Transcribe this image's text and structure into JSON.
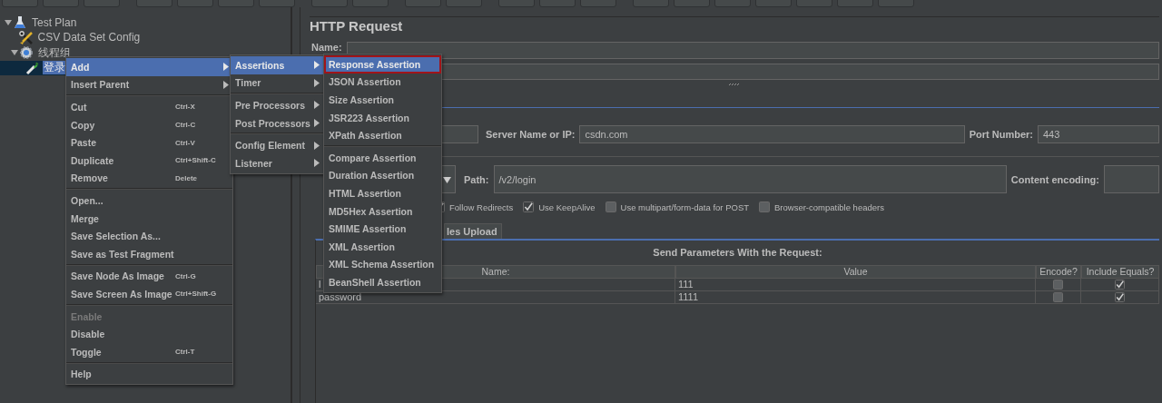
{
  "tree": [
    {
      "label": "Test Plan",
      "kind": "flask",
      "expanded": true,
      "selected": false,
      "children": [
        {
          "label": "CSV Data Set Config",
          "kind": "tools",
          "selected": false
        },
        {
          "label": "线程组",
          "kind": "gear",
          "expanded": true,
          "selected": false,
          "children": [
            {
              "label": "登录",
              "kind": "pipette",
              "selected": true
            }
          ]
        }
      ]
    }
  ],
  "request": {
    "title": "HTTP Request",
    "name_label": "Name:",
    "server_label": "Server Name or IP:",
    "server": "csdn.com",
    "port_label": "Port Number:",
    "port": "443",
    "path_label": "Path:",
    "path": "/v2/login",
    "encoding_label": "Content encoding:",
    "options": [
      {
        "label": "Follow Redirects",
        "checked": true
      },
      {
        "label": "Use KeepAlive",
        "checked": true
      },
      {
        "label": "Use multipart/form-data for POST",
        "checked": false
      },
      {
        "label": "Browser-compatible headers",
        "checked": false
      }
    ],
    "tabs": [
      {
        "label": "les Upload",
        "selected": false
      }
    ],
    "parameters": {
      "title": "Send Parameters With the Request:",
      "columns": [
        "Name:",
        "Value",
        "Encode?",
        "Include Equals?"
      ],
      "rows": [
        {
          "name": "l",
          "value": "111",
          "encode": false,
          "include_equals": true
        },
        {
          "name": "password",
          "value": "1111",
          "encode": false,
          "include_equals": true
        }
      ]
    }
  },
  "context_menu": {
    "groups": [
      [
        {
          "label": "Add",
          "submenu": true,
          "selected": true,
          "disabled": false
        },
        {
          "label": "Insert Parent",
          "submenu": true,
          "selected": false,
          "disabled": false
        }
      ],
      [
        {
          "label": "Cut",
          "shortcut": "Ctrl-X",
          "submenu": false,
          "selected": false,
          "disabled": false
        },
        {
          "label": "Copy",
          "shortcut": "Ctrl-C",
          "submenu": false,
          "selected": false,
          "disabled": false
        },
        {
          "label": "Paste",
          "shortcut": "Ctrl-V",
          "submenu": false,
          "selected": false,
          "disabled": false
        },
        {
          "label": "Duplicate",
          "shortcut": "Ctrl+Shift-C",
          "submenu": false,
          "selected": false,
          "disabled": false
        },
        {
          "label": "Remove",
          "shortcut": "Delete",
          "submenu": false,
          "selected": false,
          "disabled": false
        }
      ],
      [
        {
          "label": "Open...",
          "submenu": false,
          "selected": false,
          "disabled": false
        },
        {
          "label": "Merge",
          "submenu": false,
          "selected": false,
          "disabled": false
        },
        {
          "label": "Save Selection As...",
          "submenu": false,
          "selected": false,
          "disabled": false
        },
        {
          "label": "Save as Test Fragment",
          "submenu": false,
          "selected": false,
          "disabled": false
        }
      ],
      [
        {
          "label": "Save Node As Image",
          "shortcut": "Ctrl-G",
          "submenu": false,
          "selected": false,
          "disabled": false
        },
        {
          "label": "Save Screen As Image",
          "shortcut": "Ctrl+Shift-G",
          "submenu": false,
          "selected": false,
          "disabled": false
        }
      ],
      [
        {
          "label": "Enable",
          "submenu": false,
          "selected": false,
          "disabled": true
        },
        {
          "label": "Disable",
          "submenu": false,
          "selected": false,
          "disabled": false
        },
        {
          "label": "Toggle",
          "shortcut": "Ctrl-T",
          "submenu": false,
          "selected": false,
          "disabled": false
        }
      ],
      [
        {
          "label": "Help",
          "submenu": false,
          "selected": false,
          "disabled": false
        }
      ]
    ]
  },
  "add_menu": {
    "groups": [
      [
        {
          "label": "Assertions",
          "submenu": true,
          "selected": true
        },
        {
          "label": "Timer",
          "submenu": true,
          "selected": false
        }
      ],
      [
        {
          "label": "Pre Processors",
          "submenu": true,
          "selected": false
        },
        {
          "label": "Post Processors",
          "submenu": true,
          "selected": false
        }
      ],
      [
        {
          "label": "Config Element",
          "submenu": true,
          "selected": false
        },
        {
          "label": "Listener",
          "submenu": true,
          "selected": false
        }
      ]
    ]
  },
  "assertions_menu": {
    "groups": [
      [
        {
          "label": "Response Assertion",
          "selected": true,
          "outlined": true
        },
        {
          "label": "JSON Assertion",
          "selected": false,
          "outlined": false
        },
        {
          "label": "Size Assertion",
          "selected": false,
          "outlined": false
        },
        {
          "label": "JSR223 Assertion",
          "selected": false,
          "outlined": false
        },
        {
          "label": "XPath Assertion",
          "selected": false,
          "outlined": false
        }
      ],
      [
        {
          "label": "Compare Assertion",
          "selected": false,
          "outlined": false
        },
        {
          "label": "Duration Assertion",
          "selected": false,
          "outlined": false
        },
        {
          "label": "HTML Assertion",
          "selected": false,
          "outlined": false
        },
        {
          "label": "MD5Hex Assertion",
          "selected": false,
          "outlined": false
        },
        {
          "label": "SMIME Assertion",
          "selected": false,
          "outlined": false
        },
        {
          "label": "XML Assertion",
          "selected": false,
          "outlined": false
        },
        {
          "label": "XML Schema Assertion",
          "selected": false,
          "outlined": false
        },
        {
          "label": "BeanShell Assertion",
          "selected": false,
          "outlined": false
        }
      ]
    ]
  }
}
